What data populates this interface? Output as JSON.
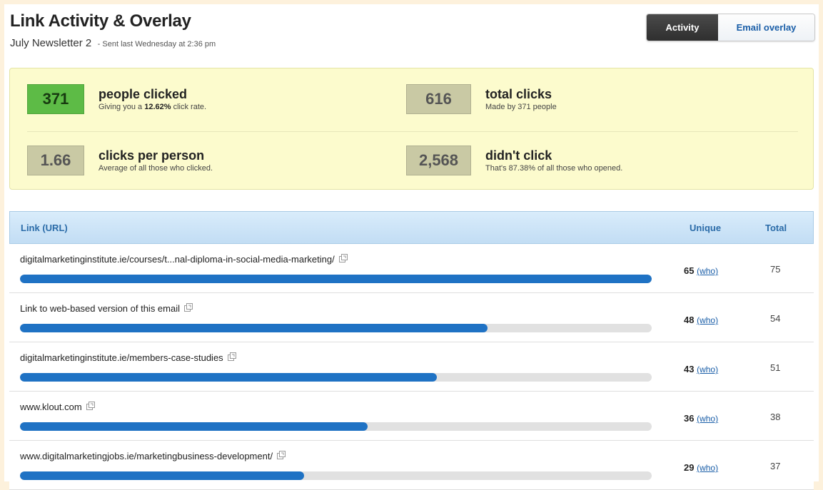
{
  "header": {
    "title": "Link Activity & Overlay",
    "subtitle": "July Newsletter 2",
    "sent": "- Sent last Wednesday at 2:36 pm"
  },
  "toggle": {
    "activity_label": "Activity",
    "email_overlay_label": "Email overlay",
    "active": "Activity"
  },
  "stats": {
    "people_clicked": {
      "value": "371",
      "label": "people clicked",
      "desc_prefix": "Giving you a",
      "desc_highlight": "12.62%",
      "desc_suffix": "click rate."
    },
    "total_clicks": {
      "value": "616",
      "label": "total clicks",
      "desc": "Made by 371 people"
    },
    "clicks_per_person": {
      "value": "1.66",
      "label": "clicks per person",
      "desc": "Average of all those who clicked."
    },
    "didnt_click": {
      "value": "2,568",
      "label": "didn't click",
      "desc": "That's 87.38% of all those who opened."
    }
  },
  "table": {
    "columns": {
      "link": "Link (URL)",
      "unique": "Unique",
      "total": "Total"
    },
    "who_label": "(who)",
    "rows": [
      {
        "url": "digitalmarketinginstitute.ie/courses/t...nal-diploma-in-social-media-marketing/",
        "unique": "65",
        "total": "75",
        "bar_fraction": 1.0
      },
      {
        "url": "Link to web-based version of this email",
        "unique": "48",
        "total": "54",
        "bar_fraction": 0.74
      },
      {
        "url": "digitalmarketinginstitute.ie/members-case-studies",
        "unique": "43",
        "total": "51",
        "bar_fraction": 0.66
      },
      {
        "url": "www.klout.com",
        "unique": "36",
        "total": "38",
        "bar_fraction": 0.55
      },
      {
        "url": "www.digitalmarketingjobs.ie/marketingbusiness-development/",
        "unique": "29",
        "total": "37",
        "bar_fraction": 0.45
      }
    ]
  },
  "colors": {
    "bar": "#1f72c4",
    "highlight_green": "#5dbb46",
    "stats_bg": "#fcfbcd",
    "header_bg": "#c2ddf4"
  }
}
